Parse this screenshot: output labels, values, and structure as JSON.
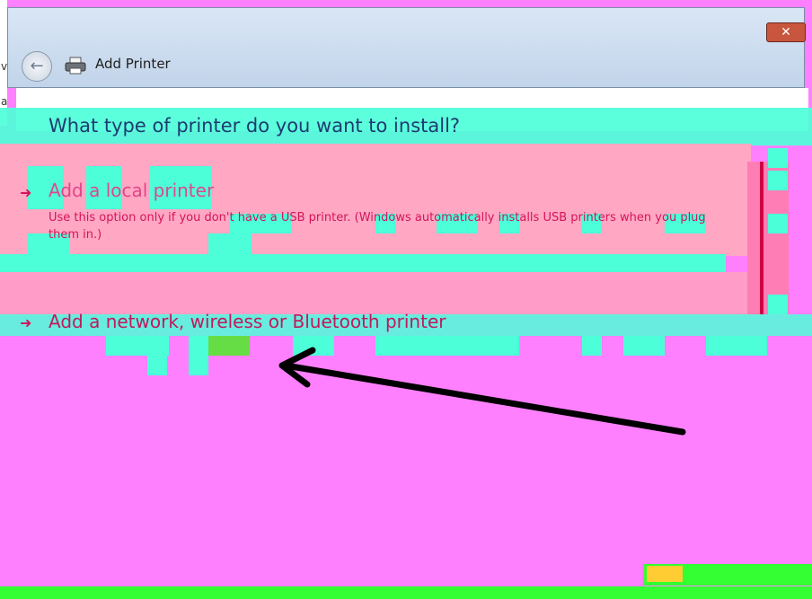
{
  "window": {
    "title": "Add Printer",
    "close_label": "✕"
  },
  "left_fragments": [
    "v",
    "a"
  ],
  "wizard": {
    "heading": "What type of printer do you want to install?",
    "options": [
      {
        "title": "Add a local printer",
        "description": "Use this option only if you don't have a USB printer. (Windows automatically installs USB printers when you plug them in.)"
      },
      {
        "title": "Add a network, wireless or Bluetooth printer"
      }
    ]
  },
  "colors": {
    "annotation_arrow": "#000000",
    "window_chrome": "#c2d4ea",
    "close_button": "#c8553d"
  }
}
